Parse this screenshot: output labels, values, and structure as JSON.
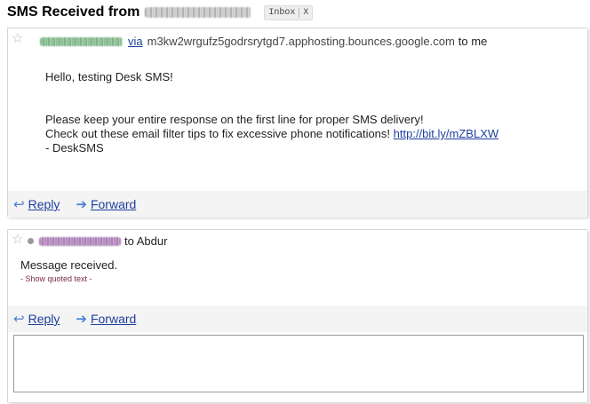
{
  "subject": {
    "title": "SMS Received from",
    "label": "Inbox",
    "label_close": "X"
  },
  "message1": {
    "via_label": "via",
    "origin": "m3kw2wrgufz5godrsrytgd7.apphosting.bounces.google.com",
    "recipient": "to me",
    "body_lines": [
      "Hello, testing Desk SMS!",
      "",
      "",
      "Please keep your entire response on the first line for proper SMS delivery!",
      "Check out these email filter tips to fix excessive phone notifications!",
      "- DeskSMS"
    ],
    "link_text": "http://bit.ly/mZBLXW",
    "reply_label": "Reply",
    "forward_label": "Forward"
  },
  "message2": {
    "recipient": "to Abdur",
    "body": "Message received.",
    "quoted_toggle": "- Show quoted text -",
    "reply_label": "Reply",
    "forward_label": "Forward"
  },
  "icons": {
    "star": "star-icon",
    "reply": "reply-arrow-icon",
    "forward": "forward-arrow-icon",
    "status": "status-dot-icon"
  }
}
